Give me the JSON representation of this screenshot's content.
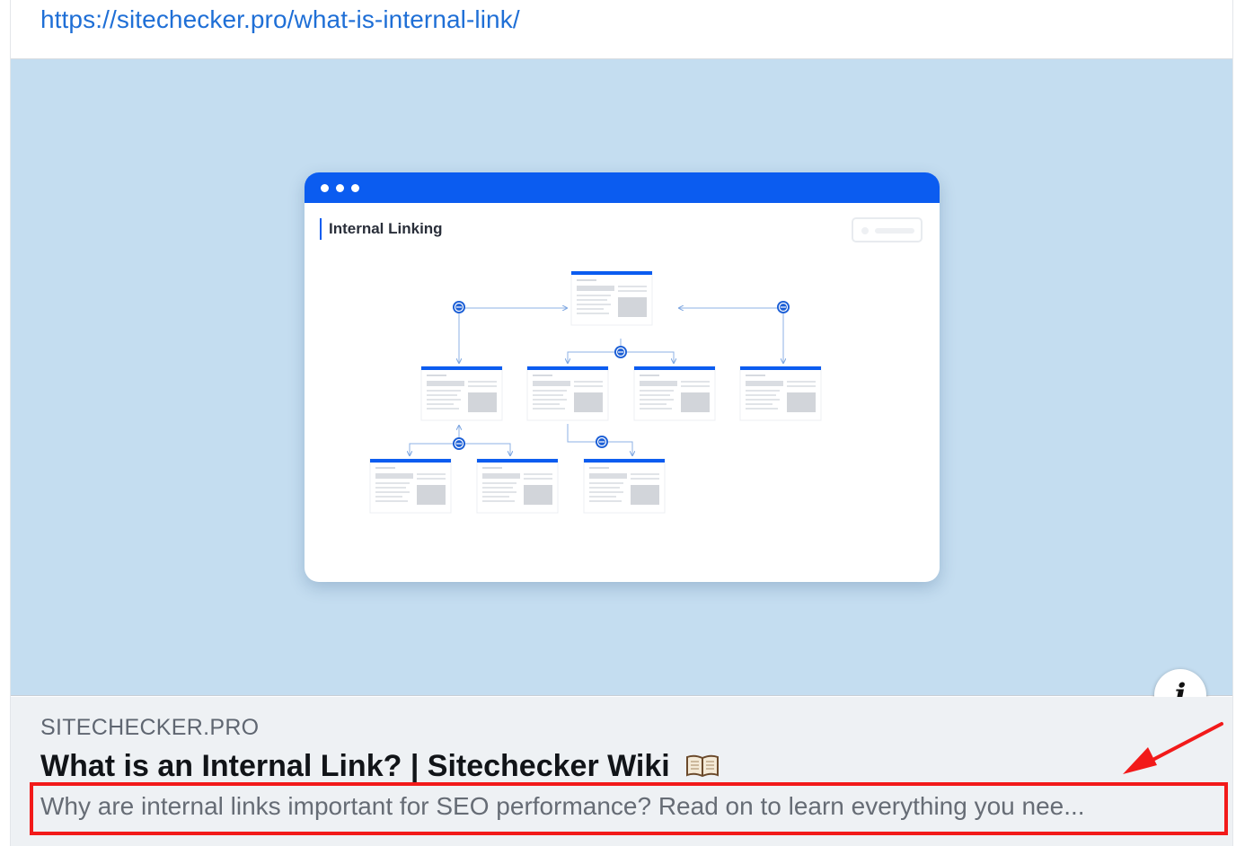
{
  "link_preview": {
    "url": "https://sitechecker.pro/what-is-internal-link/",
    "image": {
      "window_title": "Internal Linking",
      "background_color": "#c4ddf0",
      "accent_color": "#0b5cf0"
    },
    "info_icon": "info-icon",
    "domain": "SITECHECKER.PRO",
    "title": "What is an Internal Link? | Sitechecker Wiki",
    "title_icon": "open-book-icon",
    "description": "Why are internal links important for SEO performance? Read on to learn everything you nee..."
  },
  "annotation": {
    "highlight_color": "#f21a1a",
    "arrow_icon": "red-arrow-icon"
  },
  "colors": {
    "link": "#1f6fd6",
    "domain_text": "#5f6671",
    "title_text": "#111418",
    "description_text": "#666c75",
    "meta_background": "#eef1f4"
  }
}
